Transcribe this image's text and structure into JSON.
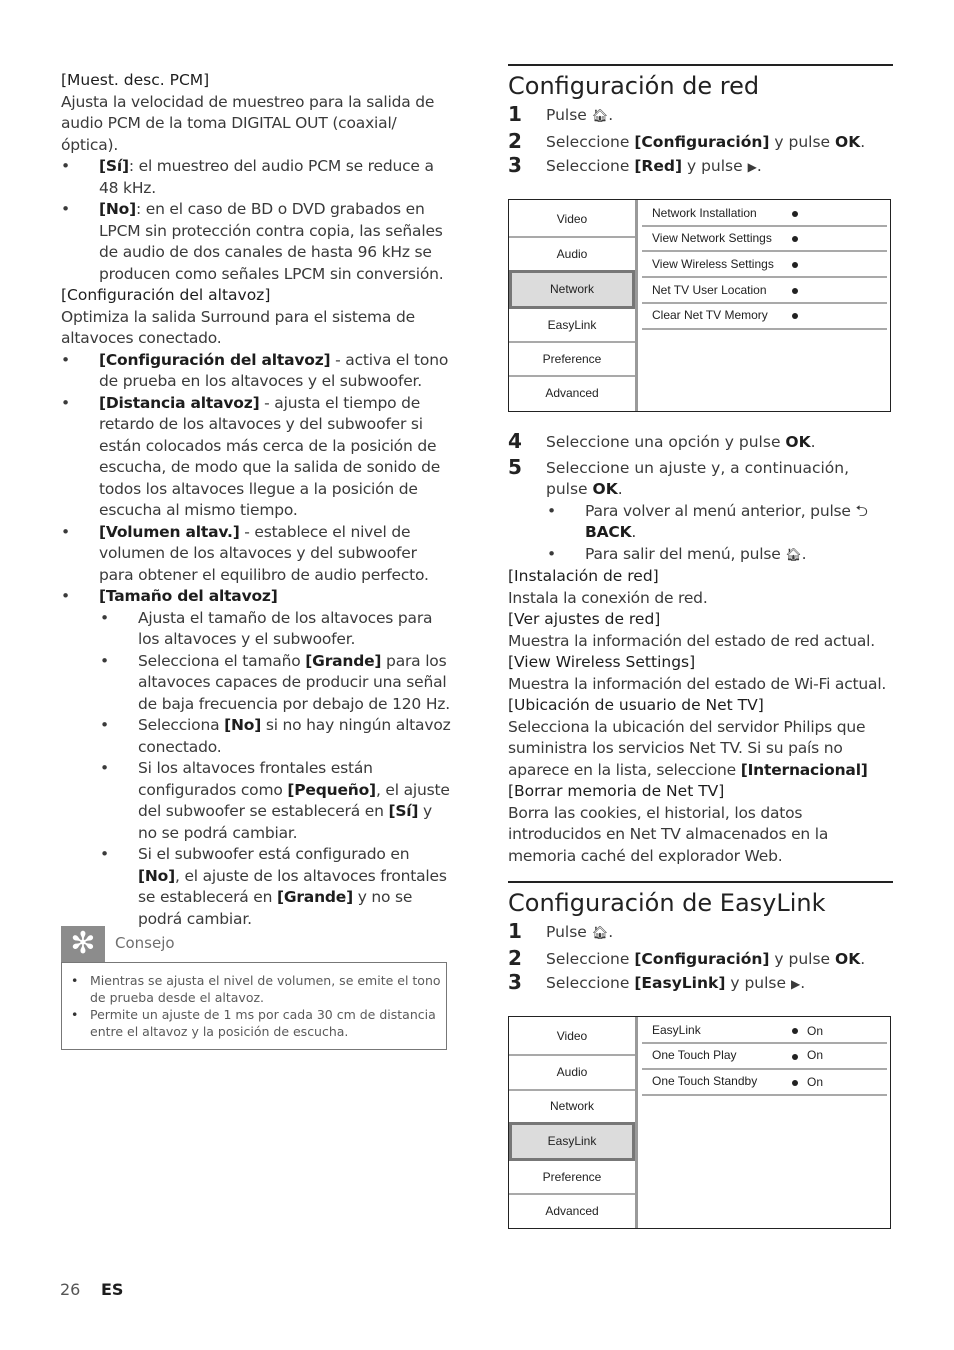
{
  "left": {
    "pcm_label": "[Muest. desc. PCM]",
    "pcm_desc": "Ajusta la velocidad de muestreo para la salida de audio PCM de la toma DIGITAL OUT (coaxial/óptica).",
    "pcm_bullets": [
      {
        "key": "[Sí]",
        "text": ": el muestreo del audio PCM se reduce a 48 kHz."
      },
      {
        "key": "[No]",
        "text": ": en el caso de BD o DVD grabados en LPCM sin protección contra copia, las señales de audio de dos canales de hasta 96 kHz se producen como señales LPCM sin conversión."
      }
    ],
    "speaker_label": "[Configuración del altavoz]",
    "speaker_desc": "Optimiza la salida Surround para el sistema de altavoces conectado.",
    "speaker_bullets": [
      {
        "key": "[Configuración del altavoz]",
        "text": " - activa el tono de prueba en los altavoces y el subwoofer."
      },
      {
        "key": "[Distancia altavoz]",
        "text": " - ajusta el tiempo de retardo de los altavoces y del subwoofer si están colocados más cerca de la posición de escucha, de modo que la salida de sonido de todos los altavoces llegue a la posición de escucha al mismo tiempo."
      },
      {
        "key": "[Volumen altav.]",
        "text": " - establece el nivel de volumen de los altavoces y del subwoofer para obtener el equilibro de audio perfecto."
      }
    ],
    "size_label": "[Tamaño del altavoz]",
    "size_sub": [
      {
        "pre": "Ajusta el tamaño de los altavoces para los altavoces y el subwoofer."
      },
      {
        "pre": "Selecciona el tamaño ",
        "key": "[Grande]",
        "post": " para los altavoces capaces de producir una señal de baja frecuencia por debajo de 120 Hz."
      },
      {
        "pre": "Selecciona ",
        "key": "[No]",
        "post": " si no hay ningún altavoz conectado."
      },
      {
        "pre": "Si los altavoces frontales están configurados como ",
        "key": "[Pequeño]",
        "post": ", el ajuste del subwoofer se establecerá en ",
        "key2": "[Sí]",
        "post2": " y no se podrá cambiar."
      },
      {
        "pre": "Si el subwoofer está configurado en ",
        "key": "[No]",
        "post": ", el ajuste de los altavoces frontales se establecerá en ",
        "key2": "[Grande]",
        "post2": " y no se podrá cambiar."
      }
    ],
    "tip": {
      "icon": "tip-icon",
      "title": "Consejo",
      "items": [
        "Mientras se ajusta el nivel de volumen, se emite el tono de prueba desde el altavoz.",
        "Permite un ajuste de 1 ms por cada 30 cm de distancia entre el altavoz y la posición de escucha."
      ]
    }
  },
  "network_section": {
    "title": "Configuración de red",
    "steps": [
      {
        "n": "1",
        "pre": "Pulse ",
        "icon": "home-icon",
        "post": "."
      },
      {
        "n": "2",
        "pre": "Seleccione ",
        "key": "[Configuración]",
        "mid": " y pulse ",
        "key2": "OK",
        "post": "."
      },
      {
        "n": "3",
        "pre": "Seleccione ",
        "key": "[Red]",
        "mid": " y pulse ",
        "icon": "play-right-icon",
        "post": "."
      }
    ],
    "menu": {
      "tabs": [
        "Video",
        "Audio",
        "Network",
        "EasyLink",
        "Preference",
        "Advanced"
      ],
      "selected": "Network",
      "options": [
        "Network Installation",
        "View Network Settings",
        "View Wireless Settings",
        "Net TV User Location",
        "Clear Net TV Memory"
      ]
    },
    "steps2": [
      {
        "n": "4",
        "pre": "Seleccione una opción y pulse ",
        "key": "OK",
        "post": "."
      },
      {
        "n": "5",
        "pre": "Seleccione un ajuste y, a continuación, pulse ",
        "key": "OK",
        "post": "."
      }
    ],
    "sub_bullets": [
      {
        "pre": "Para volver al menú anterior, pulse ",
        "icon": "back-icon",
        "key": "BACK",
        "post": "."
      },
      {
        "pre": "Para salir del menú, pulse ",
        "icon": "home-icon",
        "post": "."
      }
    ],
    "definitions": [
      {
        "label": "[Instalación de red]",
        "desc": "Instala la conexión de red."
      },
      {
        "label": "[Ver ajustes de red]",
        "desc": "Muestra la información del estado de red actual."
      },
      {
        "label": "[View Wireless Settings]",
        "desc": "Muestra la información del estado de Wi-Fi actual."
      },
      {
        "label": "[Ubicación de usuario de Net TV]",
        "desc": "Selecciona la ubicación del servidor Philips que suministra los servicios Net TV. Si su país no aparece en la lista, seleccione ",
        "desc_key": "[Internacional]"
      },
      {
        "label": "[Borrar memoria de Net TV]",
        "desc": "Borra las cookies, el historial, los datos introducidos en Net TV almacenados en la memoria caché del explorador Web."
      }
    ]
  },
  "easylink_section": {
    "title": "Configuración de EasyLink",
    "steps": [
      {
        "n": "1",
        "pre": "Pulse ",
        "icon": "home-icon",
        "post": "."
      },
      {
        "n": "2",
        "pre": "Seleccione ",
        "key": "[Configuración]",
        "mid": " y pulse ",
        "key2": "OK",
        "post": "."
      },
      {
        "n": "3",
        "pre": "Seleccione ",
        "key": "[EasyLink]",
        "mid": " y pulse ",
        "icon": "play-right-icon",
        "post": "."
      }
    ],
    "menu": {
      "tabs": [
        "Video",
        "Audio",
        "Network",
        "EasyLink",
        "Preference",
        "Advanced"
      ],
      "selected": "EasyLink",
      "options": [
        {
          "label": "EasyLink",
          "value": "On"
        },
        {
          "label": "One Touch Play",
          "value": "On"
        },
        {
          "label": "One Touch Standby",
          "value": "On"
        }
      ]
    }
  },
  "footer": {
    "page": "26",
    "lang": "ES"
  }
}
